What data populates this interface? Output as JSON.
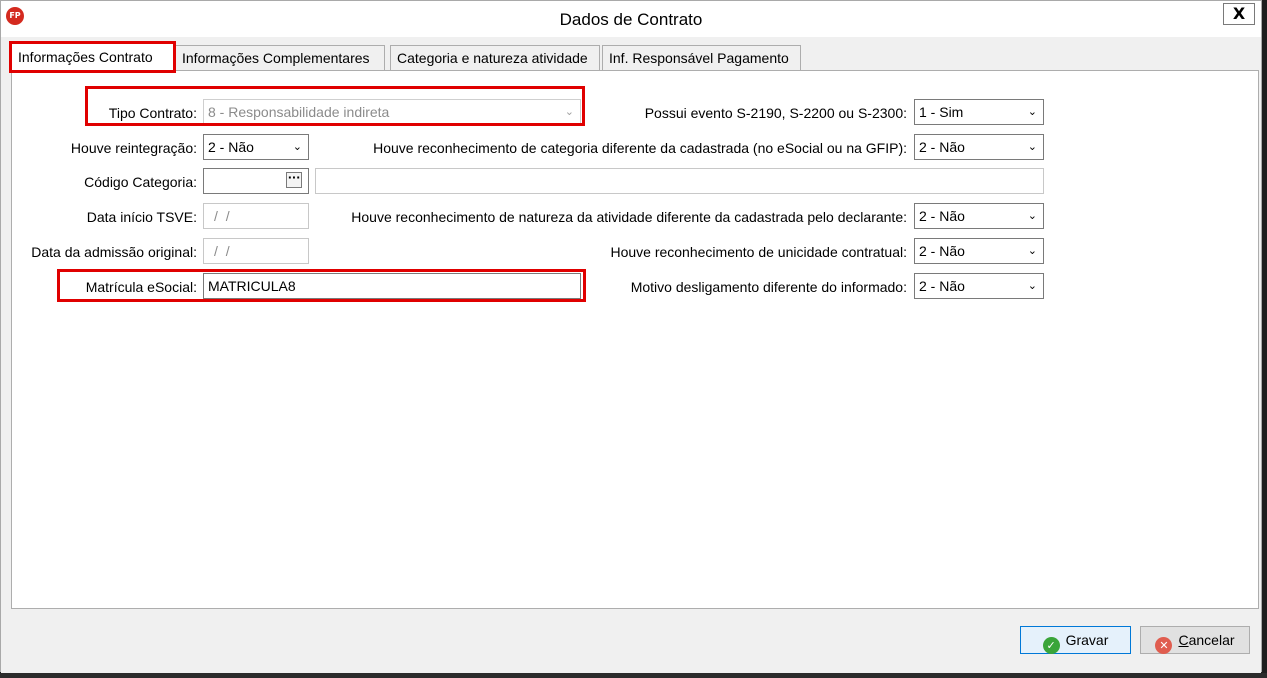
{
  "window": {
    "title": "Dados de Contrato",
    "app_icon": "FP",
    "close_label": "X"
  },
  "tabs": [
    {
      "label": "Informações Contrato",
      "active": true
    },
    {
      "label": "Informações Complementares",
      "active": false
    },
    {
      "label": "Categoria e natureza atividade",
      "active": false
    },
    {
      "label": "Inf. Responsável Pagamento",
      "active": false
    }
  ],
  "form": {
    "tipo_contrato": {
      "label": "Tipo Contrato:",
      "value": "8 - Responsabilidade indireta"
    },
    "possui_evento": {
      "label": "Possui evento S-2190, S-2200 ou S-2300:",
      "value": "1 - Sim"
    },
    "houve_reintegracao": {
      "label": "Houve reintegração:",
      "value": "2 - Não"
    },
    "reconhecimento_categoria": {
      "label": "Houve reconhecimento de categoria diferente da cadastrada (no eSocial ou na GFIP):",
      "value": "2 - Não"
    },
    "codigo_categoria": {
      "label": "Código Categoria:",
      "value": "",
      "description": "",
      "lookup_label": "···"
    },
    "data_inicio_tsve": {
      "label": "Data início TSVE:",
      "value": "/ /"
    },
    "reconhecimento_natureza": {
      "label": "Houve reconhecimento de natureza da atividade diferente da cadastrada pelo declarante:",
      "value": "2 - Não"
    },
    "data_admissao": {
      "label": "Data da admissão original:",
      "value": "/ /"
    },
    "reconhecimento_unicidade": {
      "label": "Houve reconhecimento de unicidade contratual:",
      "value": "2 - Não"
    },
    "matricula": {
      "label": "Matrícula eSocial:",
      "value": "MATRICULA8"
    },
    "motivo_desligamento": {
      "label": "Motivo desligamento diferente do informado:",
      "value": "2 - Não"
    }
  },
  "buttons": {
    "gravar": "Gravar",
    "cancelar_first": "C",
    "cancelar_rest": "ancelar"
  },
  "icons": {
    "combo_arrow": "⌄",
    "ok": "✓",
    "cancel": "✕"
  }
}
